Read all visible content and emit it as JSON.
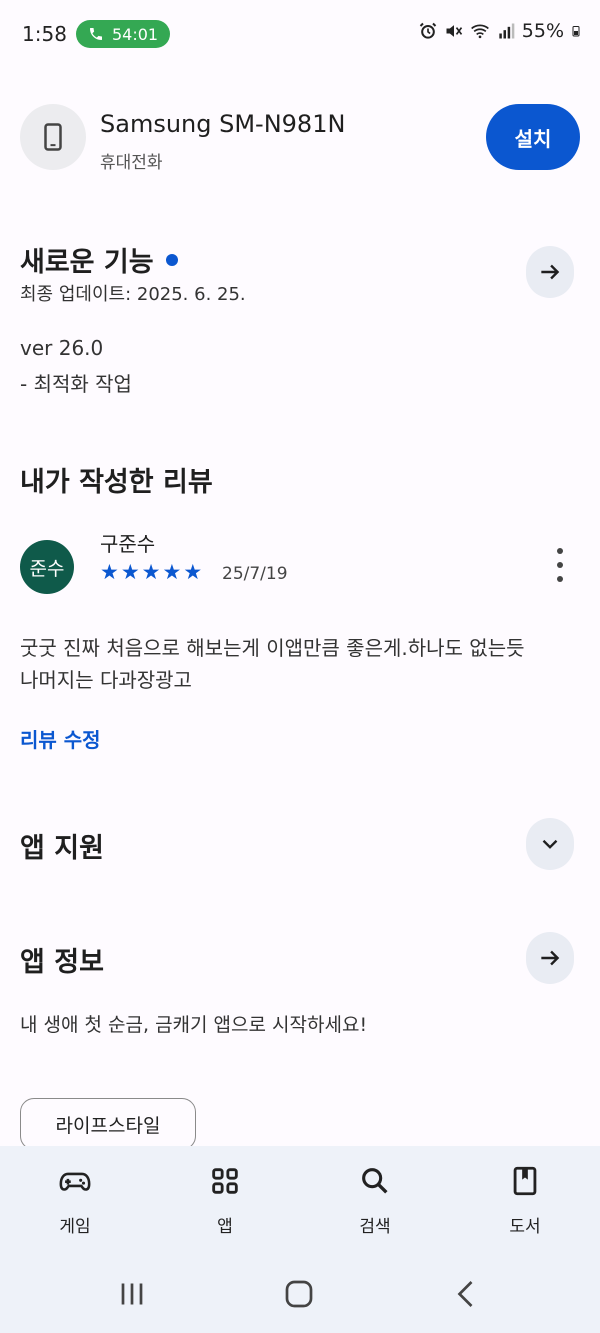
{
  "status_bar": {
    "time": "1:58",
    "call_timer": "54:01",
    "battery": "55%",
    "icons": [
      "alarm-icon",
      "mute-icon",
      "wifi-icon",
      "signal-icon",
      "battery-icon"
    ]
  },
  "device": {
    "name": "Samsung SM-N981N",
    "type": "휴대전화",
    "install_label": "설치",
    "icon": "phone-icon"
  },
  "whats_new": {
    "title": "새로운 기능",
    "updated": "최종 업데이트: 2025. 6. 25.",
    "version": "ver 26.0",
    "notes": "- 최적화 작업"
  },
  "my_review": {
    "title": "내가 작성한 리뷰",
    "avatar_text": "준수",
    "reviewer": "구준수",
    "rating": 5,
    "rating_max": 5,
    "date": "25/7/19",
    "text_line1": "굿굿 진짜 처음으로 해보는게 이앱만큼 좋은게.하나도 없는듯",
    "text_line2": "나머지는 다과장광고",
    "edit_label": "리뷰 수정"
  },
  "app_support": {
    "title": "앱 지원"
  },
  "app_info": {
    "title": "앱 정보",
    "description": "내 생애 첫 순금, 금캐기 앱으로 시작하세요!",
    "category_chip": "라이프스타일"
  },
  "bottom_nav": {
    "items": [
      {
        "label": "게임",
        "icon": "gamepad-icon"
      },
      {
        "label": "앱",
        "icon": "apps-grid-icon"
      },
      {
        "label": "검색",
        "icon": "search-icon"
      },
      {
        "label": "도서",
        "icon": "book-icon"
      }
    ]
  },
  "colors": {
    "accent": "#0b57d0",
    "background": "#fefbff",
    "nav_background": "#eef2f9",
    "avatar": "#0f5a4a",
    "call_pill": "#34a853"
  }
}
